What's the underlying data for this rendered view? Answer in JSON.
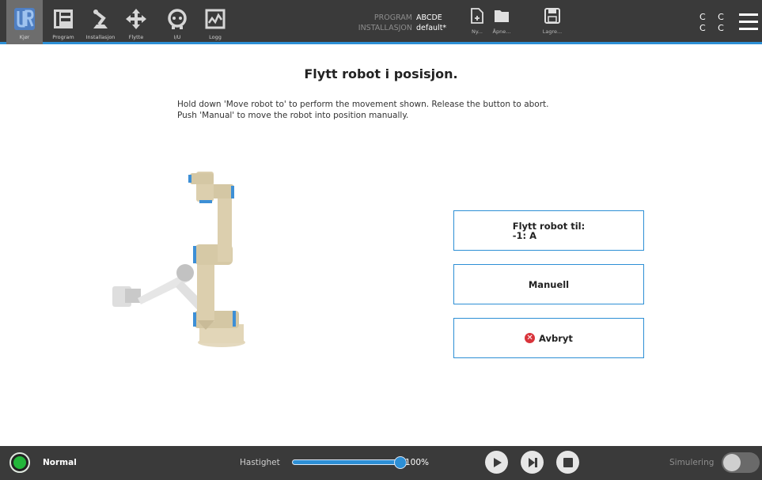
{
  "nav": {
    "items": [
      {
        "label": "Kjør",
        "icon": "ur-logo-icon"
      },
      {
        "label": "Program",
        "icon": "program-icon"
      },
      {
        "label": "Installasjon",
        "icon": "installation-icon"
      },
      {
        "label": "Flytte",
        "icon": "move-icon"
      },
      {
        "label": "I/U",
        "icon": "io-icon"
      },
      {
        "label": "Logg",
        "icon": "log-icon"
      }
    ],
    "active": "Kjør"
  },
  "program": {
    "program_key": "PROGRAM",
    "program_value": "ABCDE",
    "installation_key": "INSTALLASJON",
    "installation_value": "default*"
  },
  "file_actions": {
    "new": "Ny...",
    "open": "Åpne...",
    "save": "Lagre..."
  },
  "top_right": {
    "indicator": "C C\nC C",
    "menu_icon": "hamburger-icon"
  },
  "page": {
    "title": "Flytt robot i posisjon.",
    "instruction_line1": "Hold down 'Move robot to' to perform the movement shown. Release the button to abort.",
    "instruction_line2": "Push 'Manual' to move the robot into position manually."
  },
  "buttons": {
    "move_to_line1": "Flytt robot til:",
    "move_to_line2": "-1: A",
    "manual": "Manuell",
    "abort": "Avbryt"
  },
  "bottom": {
    "status": "Normal",
    "speed_label": "Hastighet",
    "speed_value": "100%",
    "speed_fraction": 1.0,
    "simulation_label": "Simulering",
    "simulation_on": false
  },
  "colors": {
    "accent": "#2d8fd5",
    "status_ok": "#22b63a",
    "abort_red": "#d9343b",
    "bar_bg": "#3a3a3a"
  }
}
